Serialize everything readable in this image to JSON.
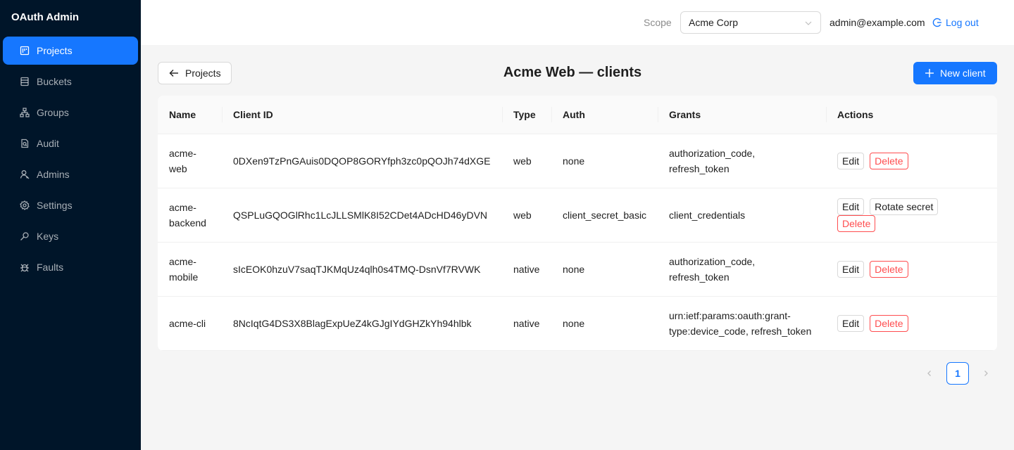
{
  "app": {
    "title": "OAuth Admin"
  },
  "sidebar": {
    "items": [
      {
        "label": "Projects",
        "icon": "projects-icon",
        "active": true
      },
      {
        "label": "Buckets",
        "icon": "buckets-icon"
      },
      {
        "label": "Groups",
        "icon": "groups-icon"
      },
      {
        "label": "Audit",
        "icon": "audit-icon"
      },
      {
        "label": "Admins",
        "icon": "admins-icon"
      },
      {
        "label": "Settings",
        "icon": "settings-icon"
      },
      {
        "label": "Keys",
        "icon": "keys-icon"
      },
      {
        "label": "Faults",
        "icon": "faults-icon"
      }
    ]
  },
  "header": {
    "scope_label": "Scope",
    "scope_value": "Acme Corp",
    "user_email": "admin@example.com",
    "logout_label": "Log out"
  },
  "page": {
    "back_label": "Projects",
    "title": "Acme Web — clients",
    "new_label": "New client"
  },
  "table": {
    "columns": [
      "Name",
      "Client ID",
      "Type",
      "Auth",
      "Grants",
      "Actions"
    ],
    "rows": [
      {
        "name": "acme-web",
        "client_id": "0DXen9TzPnGAuis0DQOP8GORYfph3zc0pQOJh74dXGE",
        "type": "web",
        "auth": "none",
        "grants": "authorization_code, refresh_token",
        "actions": [
          "Edit",
          "Delete"
        ]
      },
      {
        "name": "acme-backend",
        "client_id": "QSPLuGQOGlRhc1LcJLLSMlK8I52CDet4ADcHD46yDVN",
        "type": "web",
        "auth": "client_secret_basic",
        "grants": "client_credentials",
        "actions": [
          "Edit",
          "Rotate secret",
          "Delete"
        ]
      },
      {
        "name": "acme-mobile",
        "client_id": "sIcEOK0hzuV7saqTJKMqUz4qlh0s4TMQ-DsnVf7RVWK",
        "type": "native",
        "auth": "none",
        "grants": "authorization_code, refresh_token",
        "actions": [
          "Edit",
          "Delete"
        ]
      },
      {
        "name": "acme-cli",
        "client_id": "8NcIqtG4DS3X8BlagExpUeZ4kGJgIYdGHZkYh94hlbk",
        "type": "native",
        "auth": "none",
        "grants": "urn:ietf:params:oauth:grant-type:device_code, refresh_token",
        "actions": [
          "Edit",
          "Delete"
        ]
      }
    ]
  },
  "pagination": {
    "current": "1"
  },
  "colors": {
    "primary": "#1677ff",
    "sidebar_bg": "#001529",
    "danger": "#ff4d4f"
  }
}
